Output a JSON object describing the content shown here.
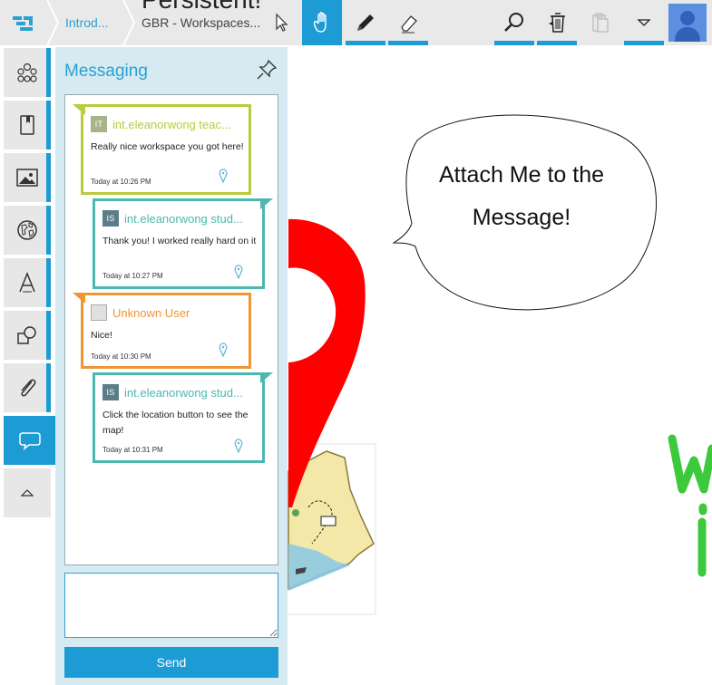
{
  "toolbar": {
    "breadcrumbs": [
      "Introd...",
      "GBR - Workspaces..."
    ],
    "canvas_title": "Persistent!"
  },
  "panel": {
    "title": "Messaging",
    "send_label": "Send",
    "compose_placeholder": ""
  },
  "messages": [
    {
      "initials": "IT",
      "user": "int.eleanorwong teac...",
      "text": "Really nice workspace you got here!",
      "time": "Today at 10:26 PM",
      "color": "#b8cc3c"
    },
    {
      "initials": "IS",
      "user": "int.eleanorwong stud...",
      "text": "Thank you! I worked really hard on it",
      "time": "Today at 10:27 PM",
      "color": "#4bb8b0"
    },
    {
      "initials": "",
      "user": "Unknown User",
      "text": "Nice!",
      "time": "Today at 10:30 PM",
      "color": "#ef9535"
    },
    {
      "initials": "IS",
      "user": "int.eleanorwong stud...",
      "text": "Click the location button to see the map!",
      "time": "Today at 10:31 PM",
      "color": "#4bb8b0"
    }
  ],
  "canvas": {
    "speech_bubble": "Attach Me to the Message!"
  },
  "colors": {
    "accent": "#1c9bd4",
    "panel_bg": "#d6eaf1",
    "teacher": "#b8cc3c",
    "student": "#4bb8b0",
    "unknown": "#ef9535",
    "pin_red": "#ff0000",
    "ink_green": "#3cc93c"
  }
}
